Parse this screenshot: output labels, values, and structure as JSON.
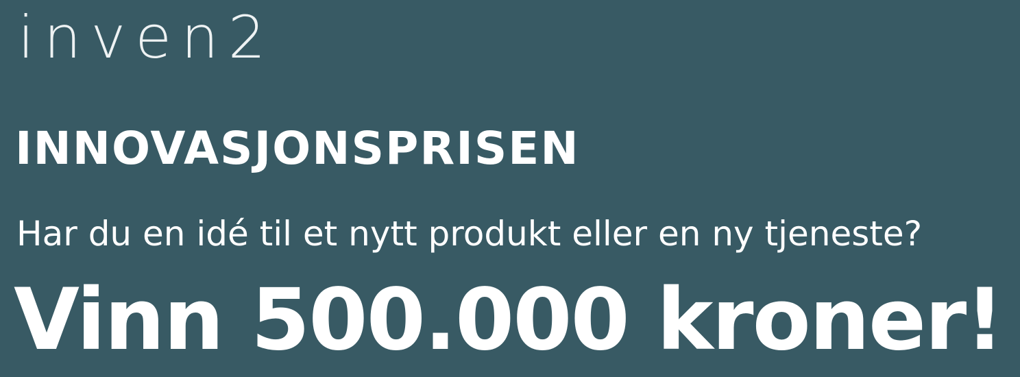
{
  "brand": {
    "logo_text": "inven2"
  },
  "banner": {
    "heading": "INNOVASJONSPRISEN",
    "question": "Har du en idé til et nytt produkt eller en ny tjeneste?",
    "prize": "Vinn 500.000 kroner!"
  },
  "colors": {
    "background": "#385a64",
    "text": "#ffffff"
  }
}
